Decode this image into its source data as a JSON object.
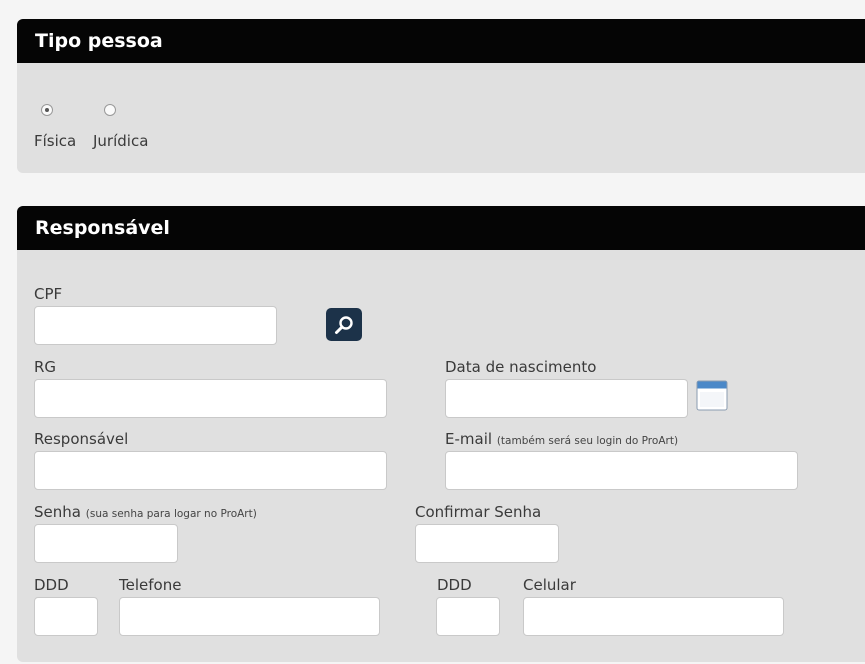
{
  "tipo_pessoa": {
    "title": "Tipo pessoa",
    "options": [
      {
        "label": "Física",
        "checked": true
      },
      {
        "label": "Jurídica",
        "checked": false
      }
    ]
  },
  "responsavel": {
    "title": "Responsável",
    "fields": {
      "cpf": {
        "label": "CPF",
        "value": ""
      },
      "rg": {
        "label": "RG",
        "value": ""
      },
      "data_nascimento": {
        "label": "Data de nascimento",
        "value": ""
      },
      "responsavel": {
        "label": "Responsável",
        "value": ""
      },
      "email": {
        "label": "E-mail",
        "hint": "(também será seu login do ProArt)",
        "value": ""
      },
      "senha": {
        "label": "Senha",
        "hint": "(sua senha para logar no ProArt)",
        "value": ""
      },
      "confirmar_senha": {
        "label": "Confirmar Senha",
        "value": ""
      },
      "ddd_telefone": {
        "label": "DDD",
        "value": ""
      },
      "telefone": {
        "label": "Telefone",
        "value": ""
      },
      "ddd_celular": {
        "label": "DDD",
        "value": ""
      },
      "celular": {
        "label": "Celular",
        "value": ""
      }
    },
    "icons": {
      "search": "magnifier-icon",
      "calendar": "calendar-icon"
    },
    "colors": {
      "search_button": "#1c3249",
      "header": "#050505",
      "panel": "#e0e0e0"
    }
  }
}
